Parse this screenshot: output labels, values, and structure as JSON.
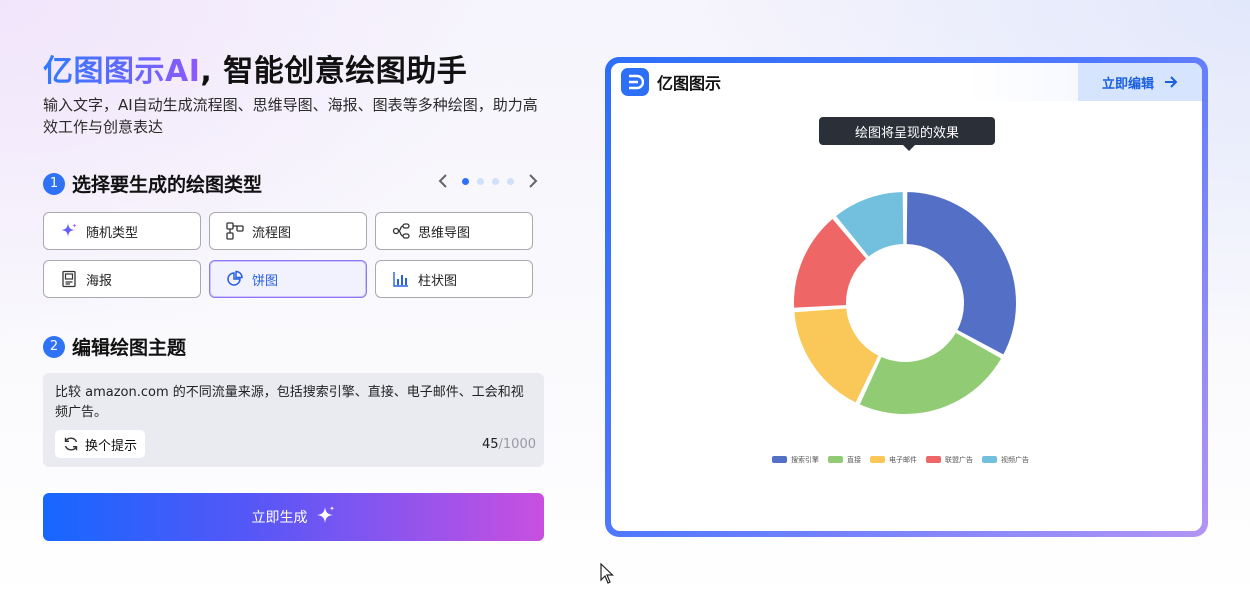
{
  "hero": {
    "brand": "亿图图示AI",
    "tagline": ", 智能创意绘图助手",
    "subtitle": "输入文字，AI自动生成流程图、思维导图、海报、图表等多种绘图，助力高效工作与创意表达"
  },
  "step1": {
    "number": "1",
    "title": "选择要生成的绘图类型",
    "pager": {
      "pages": 4,
      "active": 1
    },
    "types": [
      {
        "label": "随机类型",
        "icon": "sparkle-icon",
        "selected": false
      },
      {
        "label": "流程图",
        "icon": "flowchart-icon",
        "selected": false
      },
      {
        "label": "思维导图",
        "icon": "mindmap-icon",
        "selected": false
      },
      {
        "label": "海报",
        "icon": "poster-icon",
        "selected": false
      },
      {
        "label": "饼图",
        "icon": "pie-chart-icon",
        "selected": true
      },
      {
        "label": "柱状图",
        "icon": "bar-chart-icon",
        "selected": false
      }
    ]
  },
  "step2": {
    "number": "2",
    "title": "编辑绘图主题",
    "prompt": "比较 amazon.com 的不同流量来源，包括搜索引擎、直接、电子邮件、工会和视频广告。",
    "swap_label": "换个提示",
    "count": "45",
    "max": "/1000"
  },
  "generate_label": "立即生成",
  "preview": {
    "app_name": "亿图图示",
    "edit_label": "立即编辑",
    "tooltip": "绘图将呈现的效果"
  },
  "colors": {
    "accent": "#2f72f6",
    "series": [
      "#5470c6",
      "#91cc75",
      "#fac858",
      "#ee6666",
      "#73c0de"
    ]
  },
  "chart_data": {
    "type": "pie",
    "donut": true,
    "categories": [
      "搜索引擎",
      "直接",
      "电子邮件",
      "联盟广告",
      "视频广告"
    ],
    "values": [
      33,
      24,
      17,
      15,
      11
    ],
    "legend_position": "bottom"
  }
}
